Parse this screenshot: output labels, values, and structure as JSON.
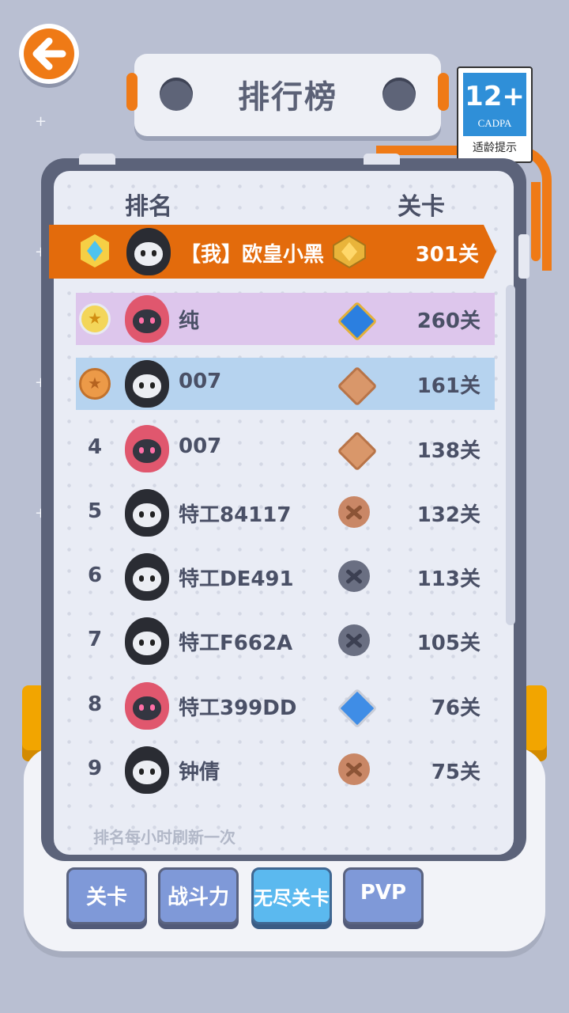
{
  "header": {
    "title": "排行榜"
  },
  "age_rating": {
    "rating": "12+",
    "org": "CADPA",
    "tip": "适龄提示"
  },
  "columns": {
    "rank": "排名",
    "level": "关卡"
  },
  "me": {
    "name": "【我】欧皇小黑",
    "levels": "301关"
  },
  "rows": [
    {
      "rank": "",
      "medal": "gold-medal",
      "avatar": "pink",
      "name": "纯",
      "badge": "sapphire-badge",
      "levels": "260关"
    },
    {
      "rank": "",
      "medal": "bronze-medal",
      "avatar": "black",
      "name": "007",
      "badge": "bronze-badge",
      "levels": "161关"
    },
    {
      "rank": "4",
      "avatar": "pink",
      "name": "007",
      "badge": "bronze-badge",
      "levels": "138关"
    },
    {
      "rank": "5",
      "avatar": "black",
      "name": "特工84117",
      "badge": "copper-round-badge",
      "levels": "132关"
    },
    {
      "rank": "6",
      "avatar": "black",
      "name": "特工DE491",
      "badge": "iron-round-badge",
      "levels": "113关"
    },
    {
      "rank": "7",
      "avatar": "black",
      "name": "特工F662A",
      "badge": "iron-round-badge",
      "levels": "105关"
    },
    {
      "rank": "8",
      "avatar": "pink",
      "name": "特工399DD",
      "badge": "silver-sapphire-badge",
      "levels": "76关"
    },
    {
      "rank": "9",
      "avatar": "black",
      "name": "钟倩",
      "badge": "copper-round-badge",
      "levels": "75关"
    }
  ],
  "footer_note": "排名每小时刷新一次",
  "tabs": [
    {
      "label": "关卡",
      "active": false
    },
    {
      "label": "战斗力",
      "active": false
    },
    {
      "label": "无尽关卡",
      "active": true
    },
    {
      "label": "PVP",
      "active": false
    }
  ],
  "colors": {
    "accent": "#ef7a16",
    "panel": "#e9ecf5",
    "frame": "#5c637a",
    "active_tab": "#5bb9ef",
    "tab": "#7f99d8"
  }
}
